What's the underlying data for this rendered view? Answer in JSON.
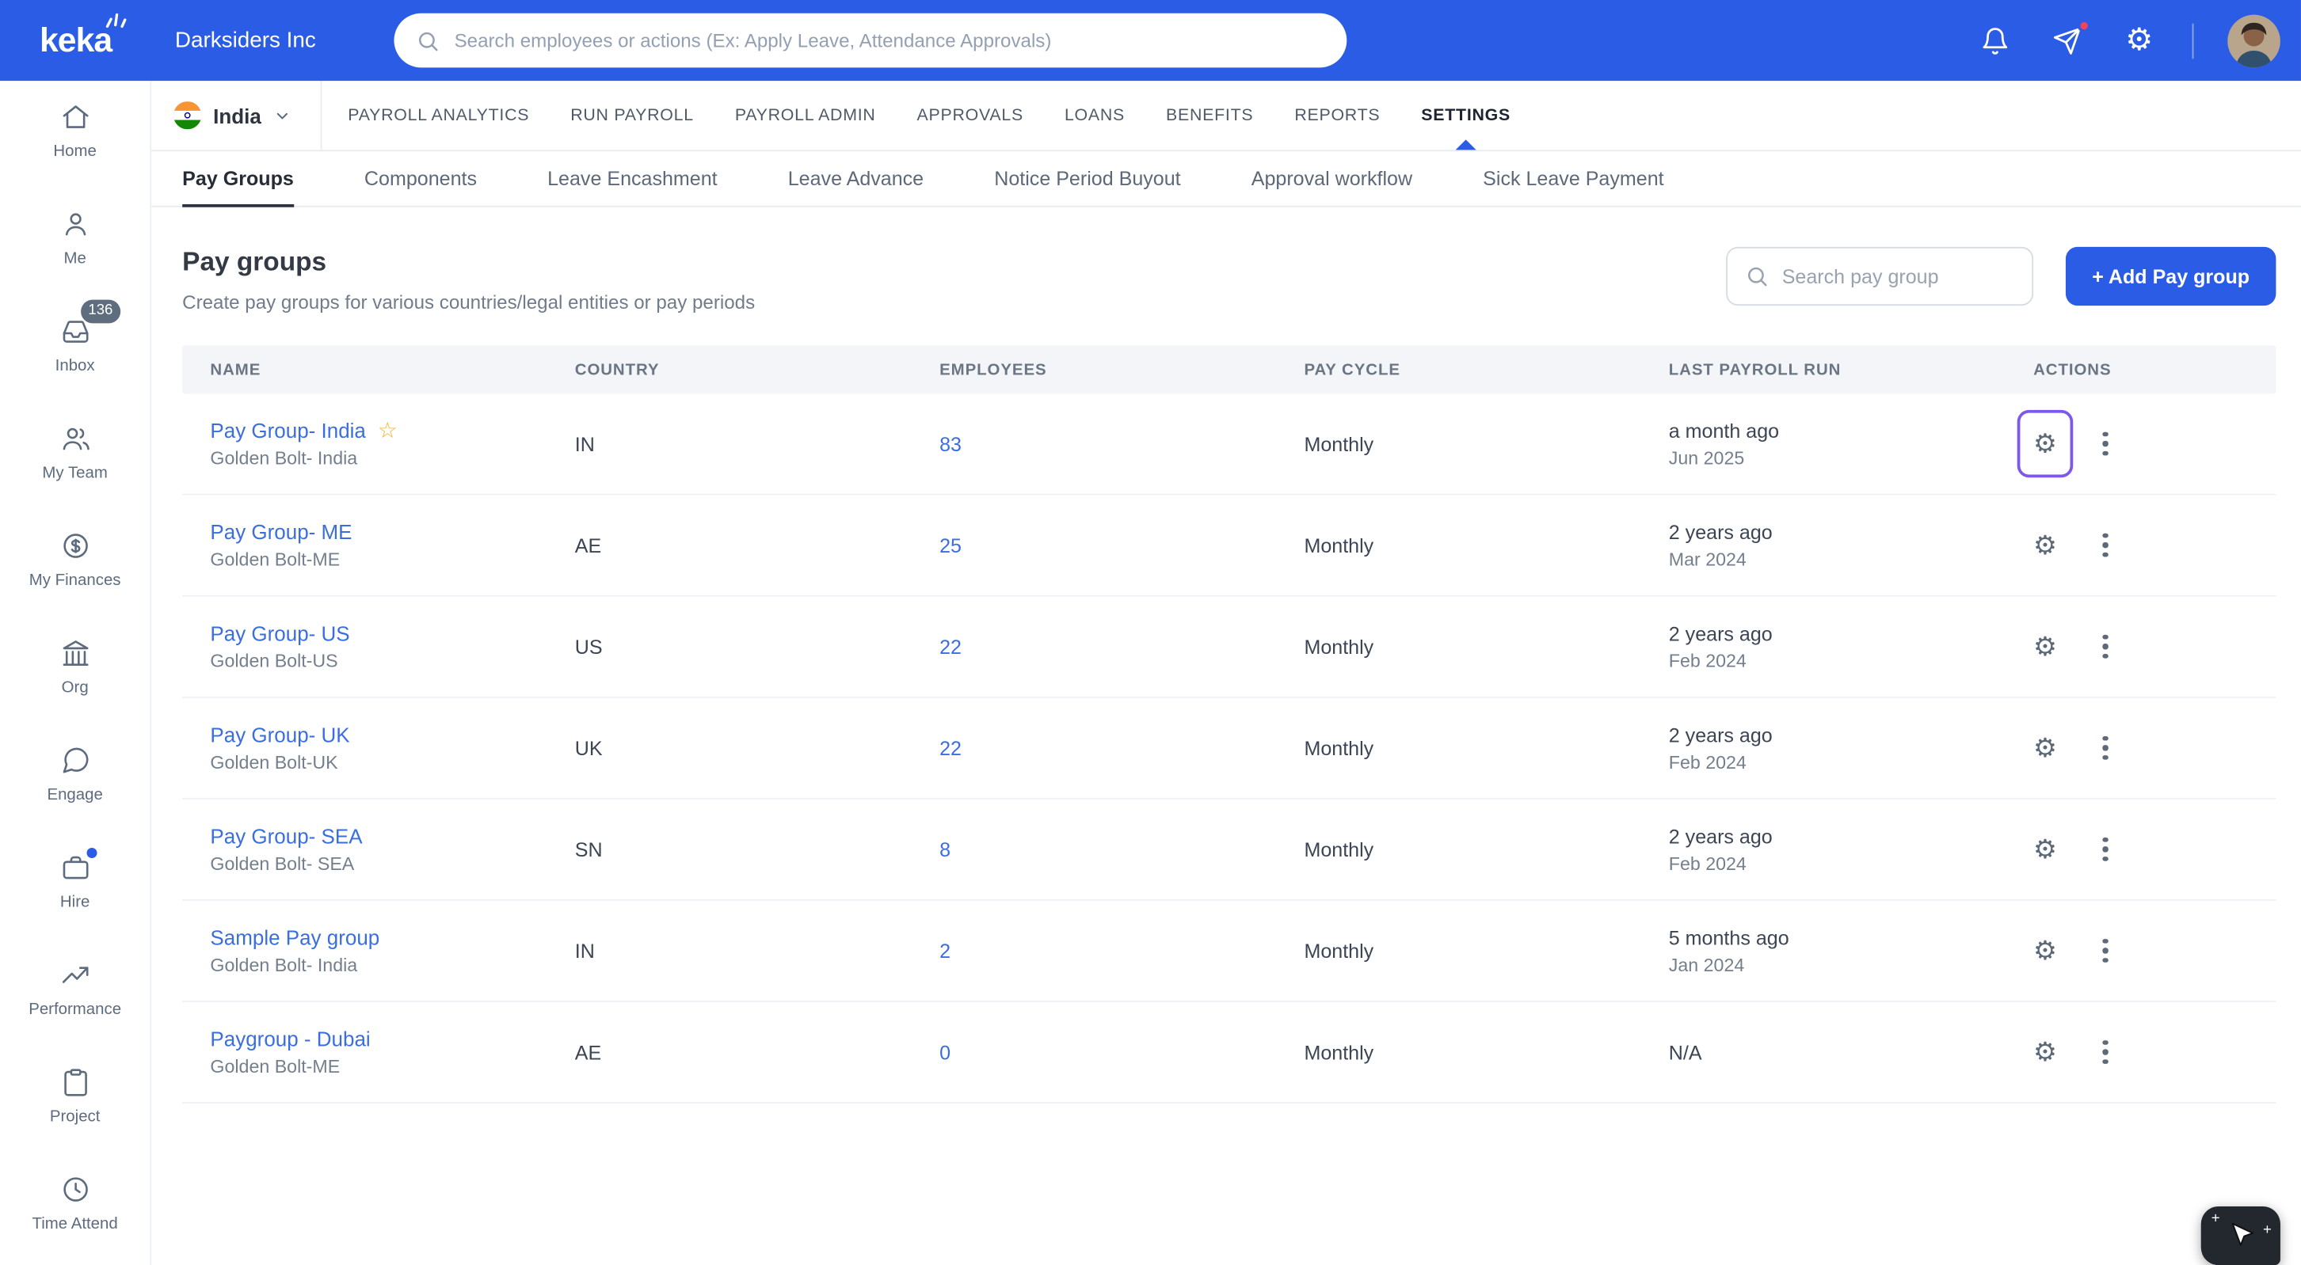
{
  "topbar": {
    "logo": "keka",
    "company": "Darksiders Inc",
    "search_placeholder": "Search employees or actions (Ex: Apply Leave, Attendance Approvals)"
  },
  "sidebar": {
    "items": [
      {
        "label": "Home"
      },
      {
        "label": "Me"
      },
      {
        "label": "Inbox",
        "badge": "136"
      },
      {
        "label": "My Team"
      },
      {
        "label": "My Finances"
      },
      {
        "label": "Org"
      },
      {
        "label": "Engage"
      },
      {
        "label": "Hire"
      },
      {
        "label": "Performance"
      },
      {
        "label": "Project"
      },
      {
        "label": "Time Attend"
      }
    ]
  },
  "nav": {
    "country": "India",
    "items": [
      {
        "label": "PAYROLL ANALYTICS"
      },
      {
        "label": "RUN PAYROLL"
      },
      {
        "label": "PAYROLL ADMIN"
      },
      {
        "label": "APPROVALS"
      },
      {
        "label": "LOANS"
      },
      {
        "label": "BENEFITS"
      },
      {
        "label": "REPORTS"
      },
      {
        "label": "SETTINGS"
      }
    ]
  },
  "tabs": [
    {
      "label": "Pay Groups"
    },
    {
      "label": "Components"
    },
    {
      "label": "Leave Encashment"
    },
    {
      "label": "Leave Advance"
    },
    {
      "label": "Notice Period Buyout"
    },
    {
      "label": "Approval workflow"
    },
    {
      "label": "Sick Leave Payment"
    }
  ],
  "page": {
    "title": "Pay groups",
    "subtitle": "Create pay groups for various countries/legal entities or pay periods",
    "search_placeholder": "Search pay group",
    "add_button": "+ Add Pay group"
  },
  "table": {
    "columns": [
      "NAME",
      "COUNTRY",
      "EMPLOYEES",
      "PAY CYCLE",
      "LAST PAYROLL RUN",
      "ACTIONS"
    ],
    "rows": [
      {
        "name": "Pay Group- India",
        "entity": "Golden Bolt- India",
        "country": "IN",
        "employees": "83",
        "pay_cycle": "Monthly",
        "last_run": "a month ago",
        "last_run_date": "Jun 2025"
      },
      {
        "name": "Pay Group- ME",
        "entity": "Golden Bolt-ME",
        "country": "AE",
        "employees": "25",
        "pay_cycle": "Monthly",
        "last_run": "2 years ago",
        "last_run_date": "Mar 2024"
      },
      {
        "name": "Pay Group- US",
        "entity": "Golden Bolt-US",
        "country": "US",
        "employees": "22",
        "pay_cycle": "Monthly",
        "last_run": "2 years ago",
        "last_run_date": "Feb 2024"
      },
      {
        "name": "Pay Group- UK",
        "entity": "Golden Bolt-UK",
        "country": "UK",
        "employees": "22",
        "pay_cycle": "Monthly",
        "last_run": "2 years ago",
        "last_run_date": "Feb 2024"
      },
      {
        "name": "Pay Group- SEA",
        "entity": "Golden Bolt- SEA",
        "country": "SN",
        "employees": "8",
        "pay_cycle": "Monthly",
        "last_run": "2 years ago",
        "last_run_date": "Feb 2024"
      },
      {
        "name": "Sample Pay group",
        "entity": "Golden Bolt- India",
        "country": "IN",
        "employees": "2",
        "pay_cycle": "Monthly",
        "last_run": "5 months ago",
        "last_run_date": "Jan 2024"
      },
      {
        "name": "Paygroup - Dubai",
        "entity": "Golden Bolt-ME",
        "country": "AE",
        "employees": "0",
        "pay_cycle": "Monthly",
        "last_run": "N/A",
        "last_run_date": ""
      }
    ]
  },
  "icons": {
    "star": "☆",
    "gear": "⚙",
    "sparkle": "+"
  },
  "colors": {
    "topbar_blue": "#2b5ce5",
    "link_blue": "#3a6ee0",
    "highlight_ring": "#7c58f0"
  }
}
